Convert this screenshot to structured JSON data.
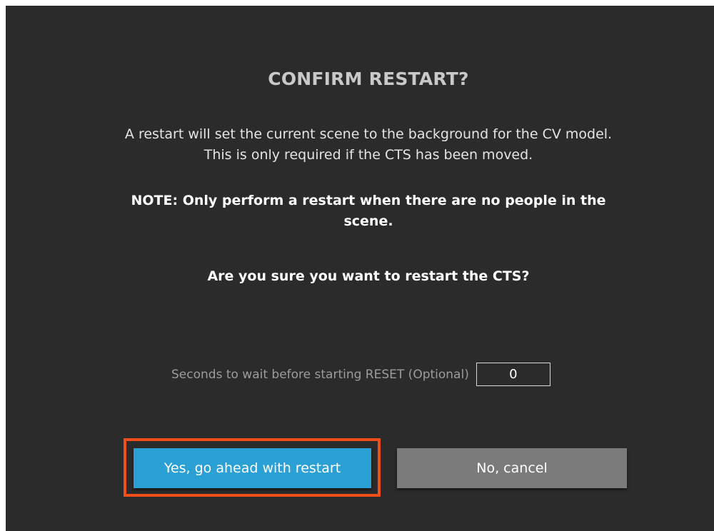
{
  "dialog": {
    "title": "CONFIRM RESTART?",
    "description_line1": "A restart will set the current scene to the background for the CV model.",
    "description_line2": "This is only required if the CTS has been moved.",
    "note_line1": "NOTE: Only perform a restart when there are no people in the",
    "note_line2": "scene.",
    "question": "Are you sure you want to restart the CTS?",
    "wait_label": "Seconds to wait before starting RESET (Optional)",
    "wait_value": "0",
    "confirm_label": "Yes, go ahead with restart",
    "cancel_label": "No, cancel"
  },
  "colors": {
    "background": "#2b2b2b",
    "confirm_button": "#2aa0d4",
    "cancel_button": "#7b7b7b",
    "highlight": "#f04e1a"
  }
}
